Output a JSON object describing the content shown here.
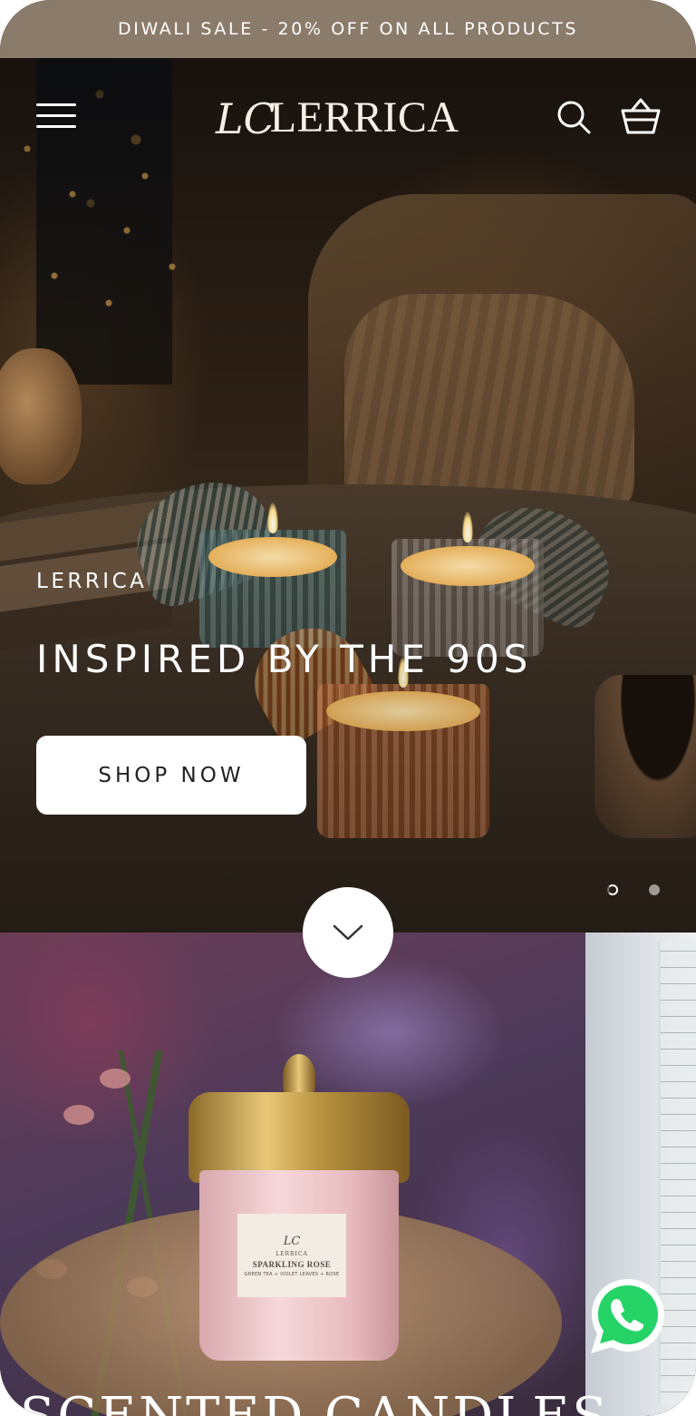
{
  "announcement": {
    "text": "DIWALI SALE - 20% OFF ON ALL PRODUCTS"
  },
  "header": {
    "menu_icon": "hamburger-menu-icon",
    "logo": {
      "monogram": "LC",
      "wordmark": "LERRICA"
    },
    "search_icon": "search-icon",
    "cart_icon": "shopping-basket-icon",
    "text_color": "#ffffff"
  },
  "hero": {
    "eyebrow": "LERRICA",
    "headline": "INSPIRED BY THE 90S",
    "cta_label": "SHOP NOW",
    "slides": {
      "total": 2,
      "current": 1
    },
    "scroll_icon": "chevron-down-icon"
  },
  "collection": {
    "title": "SCENTED CANDLES",
    "product_label": {
      "brand": "LERRICA",
      "name": "SPARKLING ROSE",
      "notes": "GREEN TEA + VIOLET LEAVES + ROSE"
    }
  },
  "floating": {
    "whatsapp_icon": "whatsapp-icon"
  },
  "colors": {
    "announcement_bg": "#8b7b6b",
    "announcement_text": "#ffffff",
    "button_bg": "#ffffff",
    "button_text": "#222222",
    "whatsapp_green": "#25d366"
  }
}
